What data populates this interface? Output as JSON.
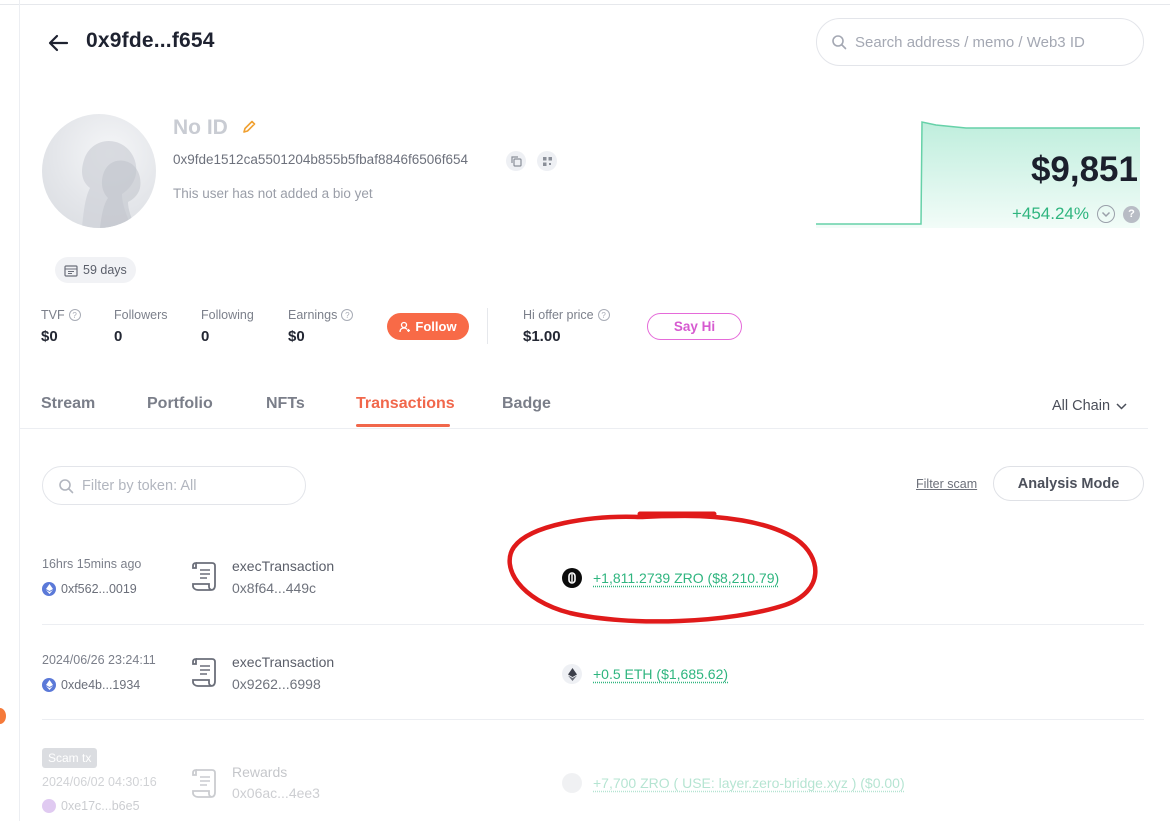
{
  "header": {
    "title": "0x9fde...f654",
    "search_placeholder": "Search address / memo / Web3 ID"
  },
  "profile": {
    "name": "No ID",
    "address": "0x9fde1512ca5501204b855b5fbaf8846f6506f654",
    "bio": "This user has not added a bio yet",
    "age": "59 days"
  },
  "balance": {
    "net_worth": "$9,851",
    "change": "+454.24%",
    "change_color": "#2fb57f"
  },
  "stats": {
    "tvf_label": "TVF",
    "tvf_value": "$0",
    "followers_label": "Followers",
    "followers_value": "0",
    "following_label": "Following",
    "following_value": "0",
    "earnings_label": "Earnings",
    "earnings_value": "$0",
    "follow_button": "Follow",
    "hi_offer_label": "Hi offer price",
    "hi_offer_value": "$1.00",
    "say_hi_button": "Say Hi"
  },
  "tabs": [
    {
      "label": "Stream"
    },
    {
      "label": "Portfolio"
    },
    {
      "label": "NFTs"
    },
    {
      "label": "Transactions",
      "active": true
    },
    {
      "label": "Badge"
    }
  ],
  "chain_filter": "All Chain",
  "filters": {
    "token_placeholder": "Filter by token: All",
    "filter_scam": "Filter scam",
    "analysis_mode": "Analysis Mode"
  },
  "transactions": [
    {
      "time": "16hrs 15mins ago",
      "from": "0xf562...0019",
      "method": "execTransaction",
      "hash": "0x8f64...449c",
      "token_icon": "zro-token-icon",
      "amount": "+1,811.2739 ZRO ($8,210.79)"
    },
    {
      "time": "2024/06/26 23:24:11",
      "from": "0xde4b...1934",
      "method": "execTransaction",
      "hash": "0x9262...6998",
      "token_icon": "eth-token-icon",
      "amount": "+0.5 ETH ($1,685.62)"
    },
    {
      "badge": "Scam tx",
      "time": "2024/06/02 04:30:16",
      "from": "0xe17c...b6e5",
      "method": "Rewards",
      "hash": "0x06ac...4ee3",
      "token_icon": "unknown-token-icon",
      "amount": "+7,700 ZRO ( USE: layer.zero-bridge.xyz ) ($0.00)"
    }
  ],
  "colors": {
    "accent": "#f1674b",
    "positive": "#2fb57f",
    "say_hi": "#d65ad0",
    "annotation": "#e01a1a"
  }
}
